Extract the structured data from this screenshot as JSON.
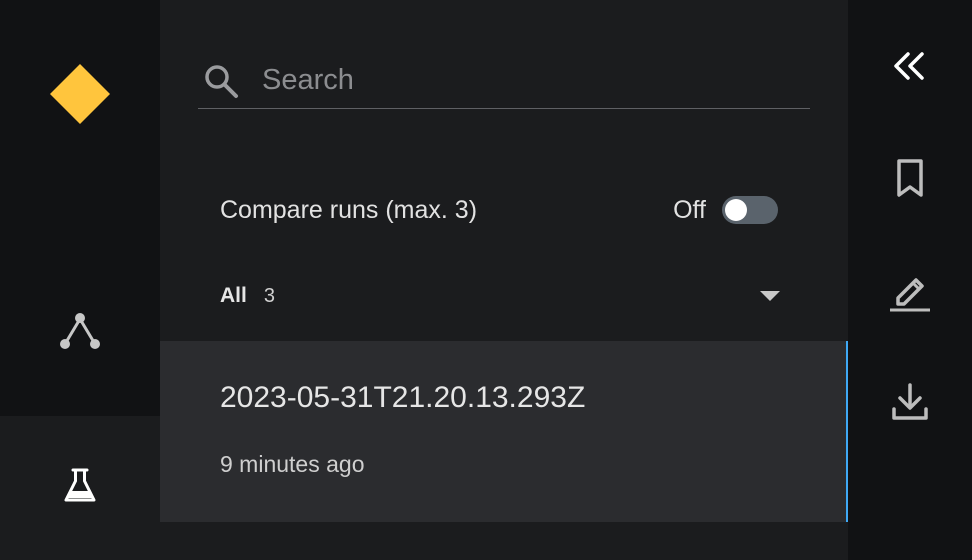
{
  "nav": {
    "logo_icon": "diamond-logo-icon",
    "logo_color": "#ffc53d",
    "items": [
      {
        "name": "pipeline",
        "icon": "flowchart-icon"
      },
      {
        "name": "experiments",
        "icon": "flask-icon",
        "active": true
      }
    ]
  },
  "search": {
    "placeholder": "Search",
    "value": ""
  },
  "compare": {
    "label": "Compare runs (max. 3)",
    "state": "Off",
    "enabled": false
  },
  "filter": {
    "label": "All",
    "count": "3"
  },
  "runs": [
    {
      "title": "2023-05-31T21.20.13.293Z",
      "time": "9 minutes ago",
      "selected": true
    }
  ],
  "tools": [
    {
      "name": "collapse",
      "icon": "double-chevron-left-icon"
    },
    {
      "name": "bookmark",
      "icon": "bookmark-icon"
    },
    {
      "name": "edit",
      "icon": "pencil-icon"
    },
    {
      "name": "download",
      "icon": "download-icon"
    }
  ],
  "colors": {
    "accent": "#3fa9f5",
    "rail_bg": "#111214",
    "panel_bg": "#1b1c1e",
    "selected_bg": "#2b2c2f"
  }
}
